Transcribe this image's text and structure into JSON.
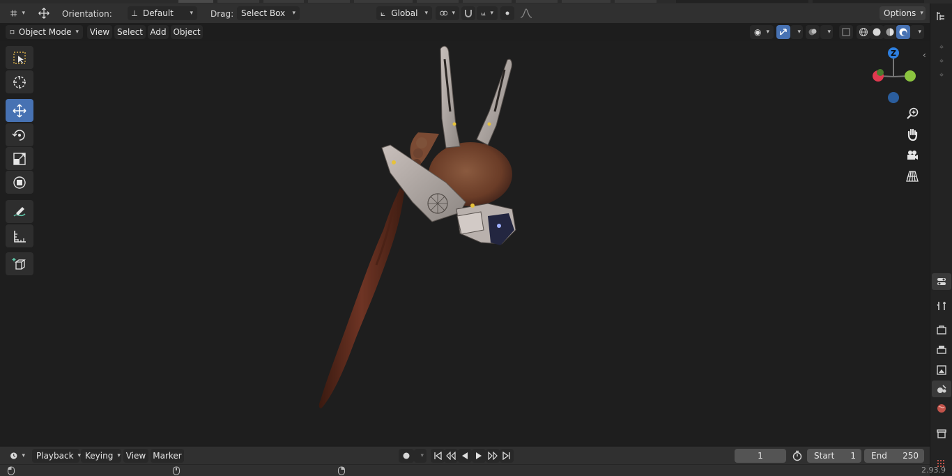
{
  "header": {
    "orientation_label": "Orientation:",
    "orientation_value": "Default",
    "drag_label": "Drag:",
    "drag_value": "Select Box",
    "transform_orientation": "Global",
    "options_label": "Options"
  },
  "viewport_header": {
    "mode": "Object Mode",
    "menus": [
      "View",
      "Select",
      "Add",
      "Object"
    ]
  },
  "toolbar": {
    "tools": [
      "select-box-icon",
      "cursor-icon",
      "move-icon",
      "rotate-icon",
      "scale-icon",
      "transform-icon",
      "annotate-icon",
      "measure-icon",
      "add-cube-icon"
    ],
    "active_tool": "move-icon"
  },
  "gizmo": {
    "z_label": "Z",
    "x_color": "#e0394f",
    "y_color": "#8bc43f",
    "z_color": "#2d7fe0",
    "neg_z_color": "#2b5e9e"
  },
  "timeline": {
    "menus": [
      "Playback",
      "Keying",
      "View",
      "Marker"
    ],
    "current_frame": "1",
    "start_label": "Start",
    "start_value": "1",
    "end_label": "End",
    "end_value": "250"
  },
  "status": {
    "version": "2.93.9"
  },
  "colors": {
    "accent": "#4772b3",
    "header_bg": "#303030",
    "viewport_bg": "#1e1e1e"
  }
}
